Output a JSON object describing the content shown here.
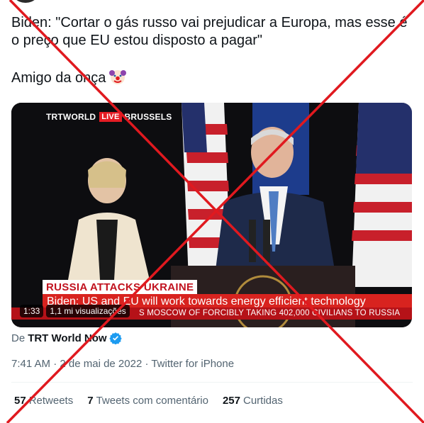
{
  "tweet": {
    "text_line1": "Biden: \"Cortar o gás russo vai prejudicar a Europa, mas esse é o preço que EU estou disposto a pagar\"",
    "text_line2": "Amigo da onça"
  },
  "video": {
    "channel_brand": "TRTWORLD",
    "live_label": "LIVE",
    "location": "BRUSSELS",
    "headline": "RUSSIA ATTACKS UKRAINE",
    "subline": "Biden: US and EU will work towards energy efficient technology",
    "ticker": "S MOSCOW OF FORCIBLY TAKING 402,000 CIVILIANS TO RUSSIA",
    "duration": "1:33",
    "views": "1,1 mi visualizações"
  },
  "source": {
    "prefix": "De",
    "account": "TRT World Now"
  },
  "meta": "7:41 AM · 2 de mai de 2022 · Twitter for iPhone",
  "stats": [
    {
      "count": "57",
      "label": "Retweets"
    },
    {
      "count": "7",
      "label": "Tweets com comentário"
    },
    {
      "count": "257",
      "label": "Curtidas"
    }
  ],
  "colors": {
    "cross": "#e0191f",
    "verified": "#1d9bf0",
    "ticker_red": "#d8231f"
  }
}
